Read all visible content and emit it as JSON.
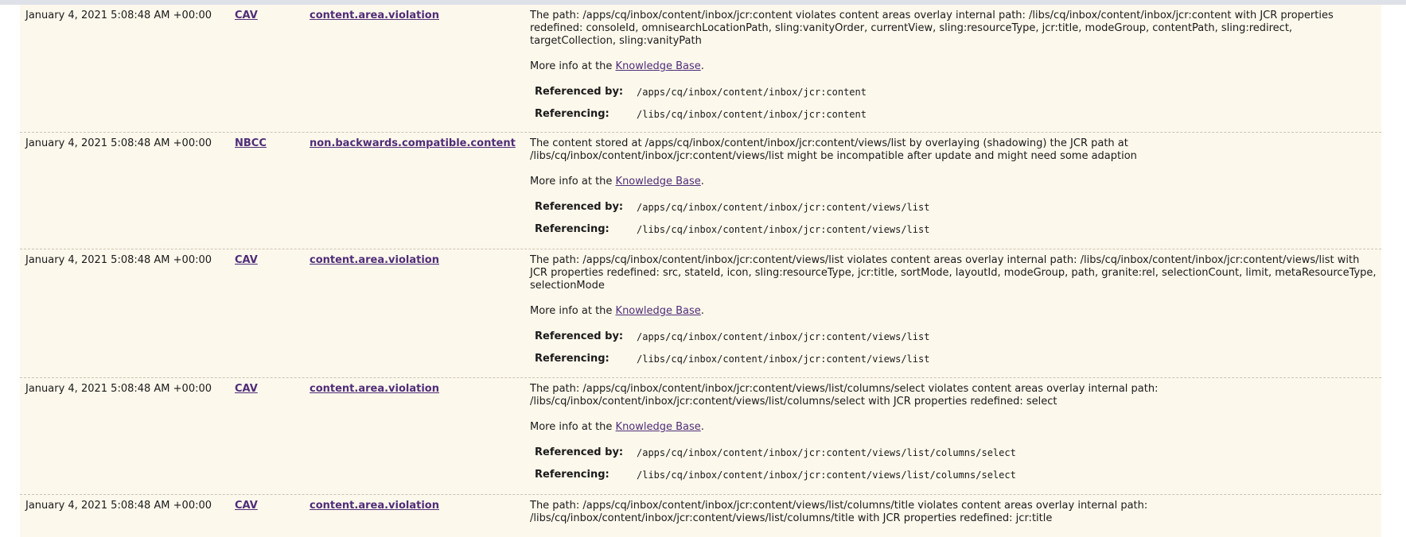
{
  "entries": [
    {
      "date": "January 4, 2021 5:08:48 AM +00:00",
      "code": "CAV",
      "type": "content.area.violation",
      "description": "The path: /apps/cq/inbox/content/inbox/jcr:content violates content areas overlay internal path: /libs/cq/inbox/content/inbox/jcr:content with JCR properties redefined: consoleId, omnisearchLocationPath, sling:vanityOrder, currentView, sling:resourceType, jcr:title, modeGroup, contentPath, sling:redirect, targetCollection, sling:vanityPath",
      "more_info_prefix": "More info at the ",
      "kb_link": "Knowledge Base",
      "more_info_suffix": ".",
      "referenced_by_label": "Referenced by:",
      "referenced_by": "/apps/cq/inbox/content/inbox/jcr:content",
      "referencing_label": "Referencing:",
      "referencing": "/libs/cq/inbox/content/inbox/jcr:content"
    },
    {
      "date": "January 4, 2021 5:08:48 AM +00:00",
      "code": "NBCC",
      "type": "non.backwards.compatible.content",
      "description": "The content stored at /apps/cq/inbox/content/inbox/jcr:content/views/list by overlaying (shadowing) the JCR path at /libs/cq/inbox/content/inbox/jcr:content/views/list might be incompatible after update and might need some adaption",
      "more_info_prefix": "More info at the ",
      "kb_link": "Knowledge Base",
      "more_info_suffix": ".",
      "referenced_by_label": "Referenced by:",
      "referenced_by": "/apps/cq/inbox/content/inbox/jcr:content/views/list",
      "referencing_label": "Referencing:",
      "referencing": "/libs/cq/inbox/content/inbox/jcr:content/views/list"
    },
    {
      "date": "January 4, 2021 5:08:48 AM +00:00",
      "code": "CAV",
      "type": "content.area.violation",
      "description": "The path: /apps/cq/inbox/content/inbox/jcr:content/views/list violates content areas overlay internal path: /libs/cq/inbox/content/inbox/jcr:content/views/list with JCR properties redefined: src, stateId, icon, sling:resourceType, jcr:title, sortMode, layoutId, modeGroup, path, granite:rel, selectionCount, limit, metaResourceType, selectionMode",
      "more_info_prefix": "More info at the ",
      "kb_link": "Knowledge Base",
      "more_info_suffix": ".",
      "referenced_by_label": "Referenced by:",
      "referenced_by": "/apps/cq/inbox/content/inbox/jcr:content/views/list",
      "referencing_label": "Referencing:",
      "referencing": "/libs/cq/inbox/content/inbox/jcr:content/views/list"
    },
    {
      "date": "January 4, 2021 5:08:48 AM +00:00",
      "code": "CAV",
      "type": "content.area.violation",
      "description": "The path: /apps/cq/inbox/content/inbox/jcr:content/views/list/columns/select violates content areas overlay internal path: /libs/cq/inbox/content/inbox/jcr:content/views/list/columns/select with JCR properties redefined: select",
      "more_info_prefix": "More info at the ",
      "kb_link": "Knowledge Base",
      "more_info_suffix": ".",
      "referenced_by_label": "Referenced by:",
      "referenced_by": "/apps/cq/inbox/content/inbox/jcr:content/views/list/columns/select",
      "referencing_label": "Referencing:",
      "referencing": "/libs/cq/inbox/content/inbox/jcr:content/views/list/columns/select"
    },
    {
      "date": "January 4, 2021 5:08:48 AM +00:00",
      "code": "CAV",
      "type": "content.area.violation",
      "description": "The path: /apps/cq/inbox/content/inbox/jcr:content/views/list/columns/title violates content areas overlay internal path: /libs/cq/inbox/content/inbox/jcr:content/views/list/columns/title with JCR properties redefined: jcr:title"
    }
  ]
}
